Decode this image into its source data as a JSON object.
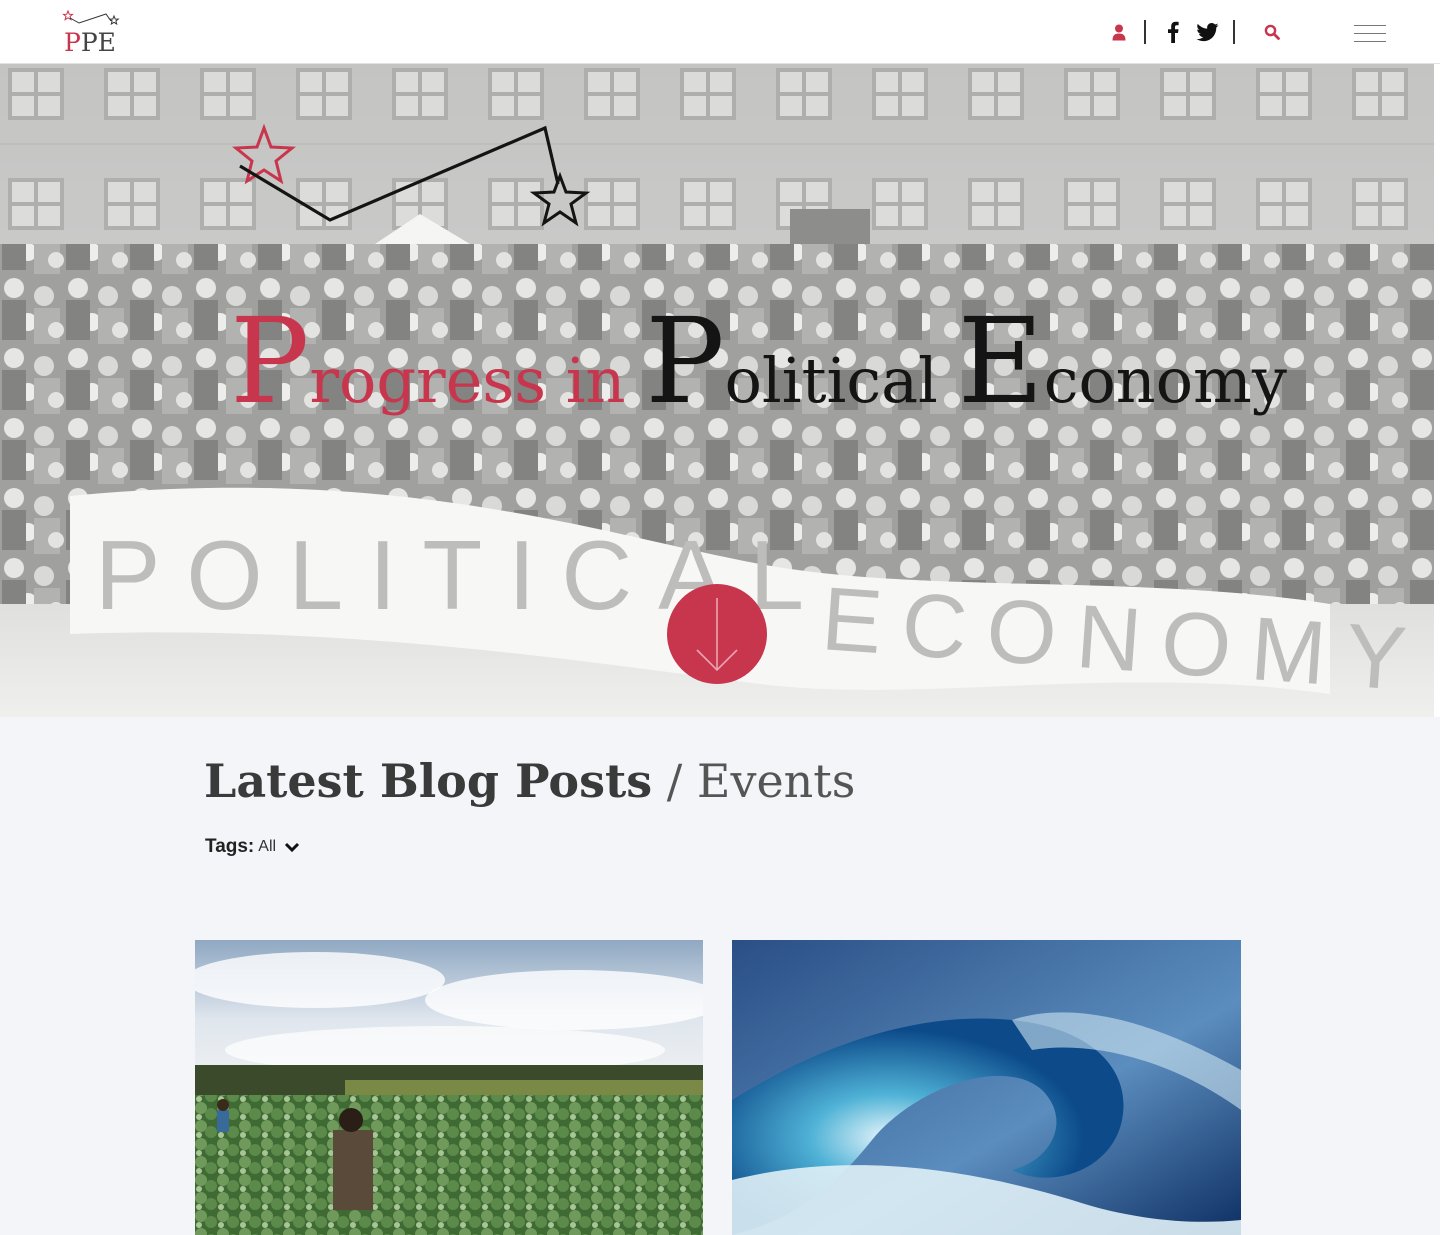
{
  "header": {
    "logo_text_first": "P",
    "logo_text_rest": "PE",
    "icons": [
      "user-icon",
      "facebook-icon",
      "twitter-icon",
      "search-icon",
      "menu-icon"
    ]
  },
  "hero": {
    "title_red_cap": "P",
    "title_red_rest": "rogress in ",
    "title_blk_cap1": "P",
    "title_blk_rest1": "olitical ",
    "title_blk_cap2": "E",
    "title_blk_rest2": "conomy",
    "banner_text_left": "POLITICAL",
    "banner_text_right": "ECONOMY"
  },
  "posts": {
    "title_strong": "Latest Blog Posts",
    "title_slash": " / ",
    "title_events": "Events",
    "tags_label": "Tags:",
    "tags_value": "All"
  },
  "colors": {
    "accent": "#c8364e",
    "background": "#f4f5f9",
    "header_bg": "#ffffff"
  }
}
